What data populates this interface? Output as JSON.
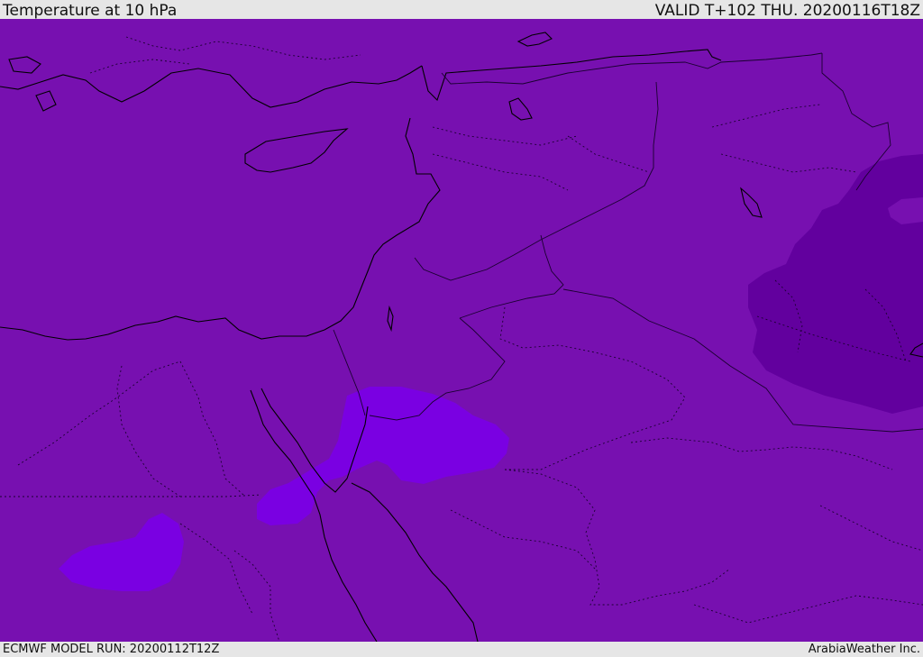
{
  "header": {
    "title": "Temperature at 10 hPa",
    "valid": "VALID T+102 THU. 20200116T18Z"
  },
  "footer": {
    "model_run": "ECMWF MODEL RUN: 20200112T12Z",
    "credit": "ArabiaWeather Inc."
  },
  "colors": {
    "background_field": "#7710b0",
    "warm_patch": "#7a00e0",
    "cold_patch": "#6200a0",
    "coastline": "#000000",
    "border": "#1a0030"
  }
}
